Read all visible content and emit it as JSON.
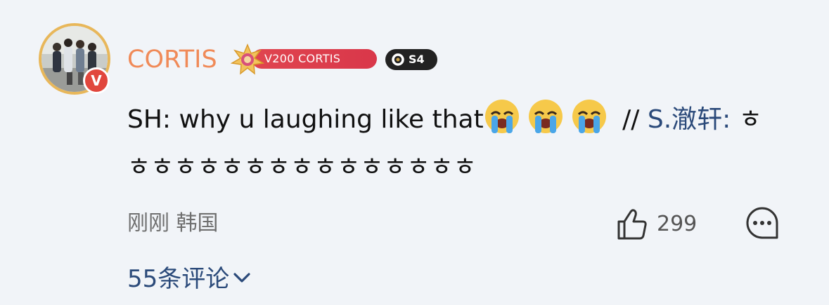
{
  "comment": {
    "username": "CORTIS",
    "fan_badge_label": "V200 CORTIS",
    "season_badge_label": "S4",
    "verified_label": "V",
    "text_main": "SH: why u laughing like that",
    "separator": " //",
    "mention": " S.澈轩",
    "mention_colon": ": ",
    "reply_text_line1": "ㅎ",
    "reply_text_line2": "ㅎㅎㅎㅎㅎㅎㅎㅎㅎㅎㅎㅎㅎㅎㅎ",
    "meta": "刚刚 韩国",
    "like_count": "299",
    "replies_label": "55条评论"
  },
  "icons": {
    "avatar": "group-photo-avatar",
    "verified": "verified-v-badge",
    "fan_medal": "golden-star-medal-icon",
    "season": "ring-icon",
    "emoji": "loudly-crying-face-emoji",
    "like": "thumbs-up-icon",
    "comment": "speech-bubble-icon",
    "expand": "chevron-down-icon"
  },
  "colors": {
    "background": "#f1f4f8",
    "username": "#f08a58",
    "link": "#2b4a7a",
    "fan_badge": "#e0454f",
    "verified": "#e1473d",
    "avatar_ring": "#e8b75a"
  }
}
